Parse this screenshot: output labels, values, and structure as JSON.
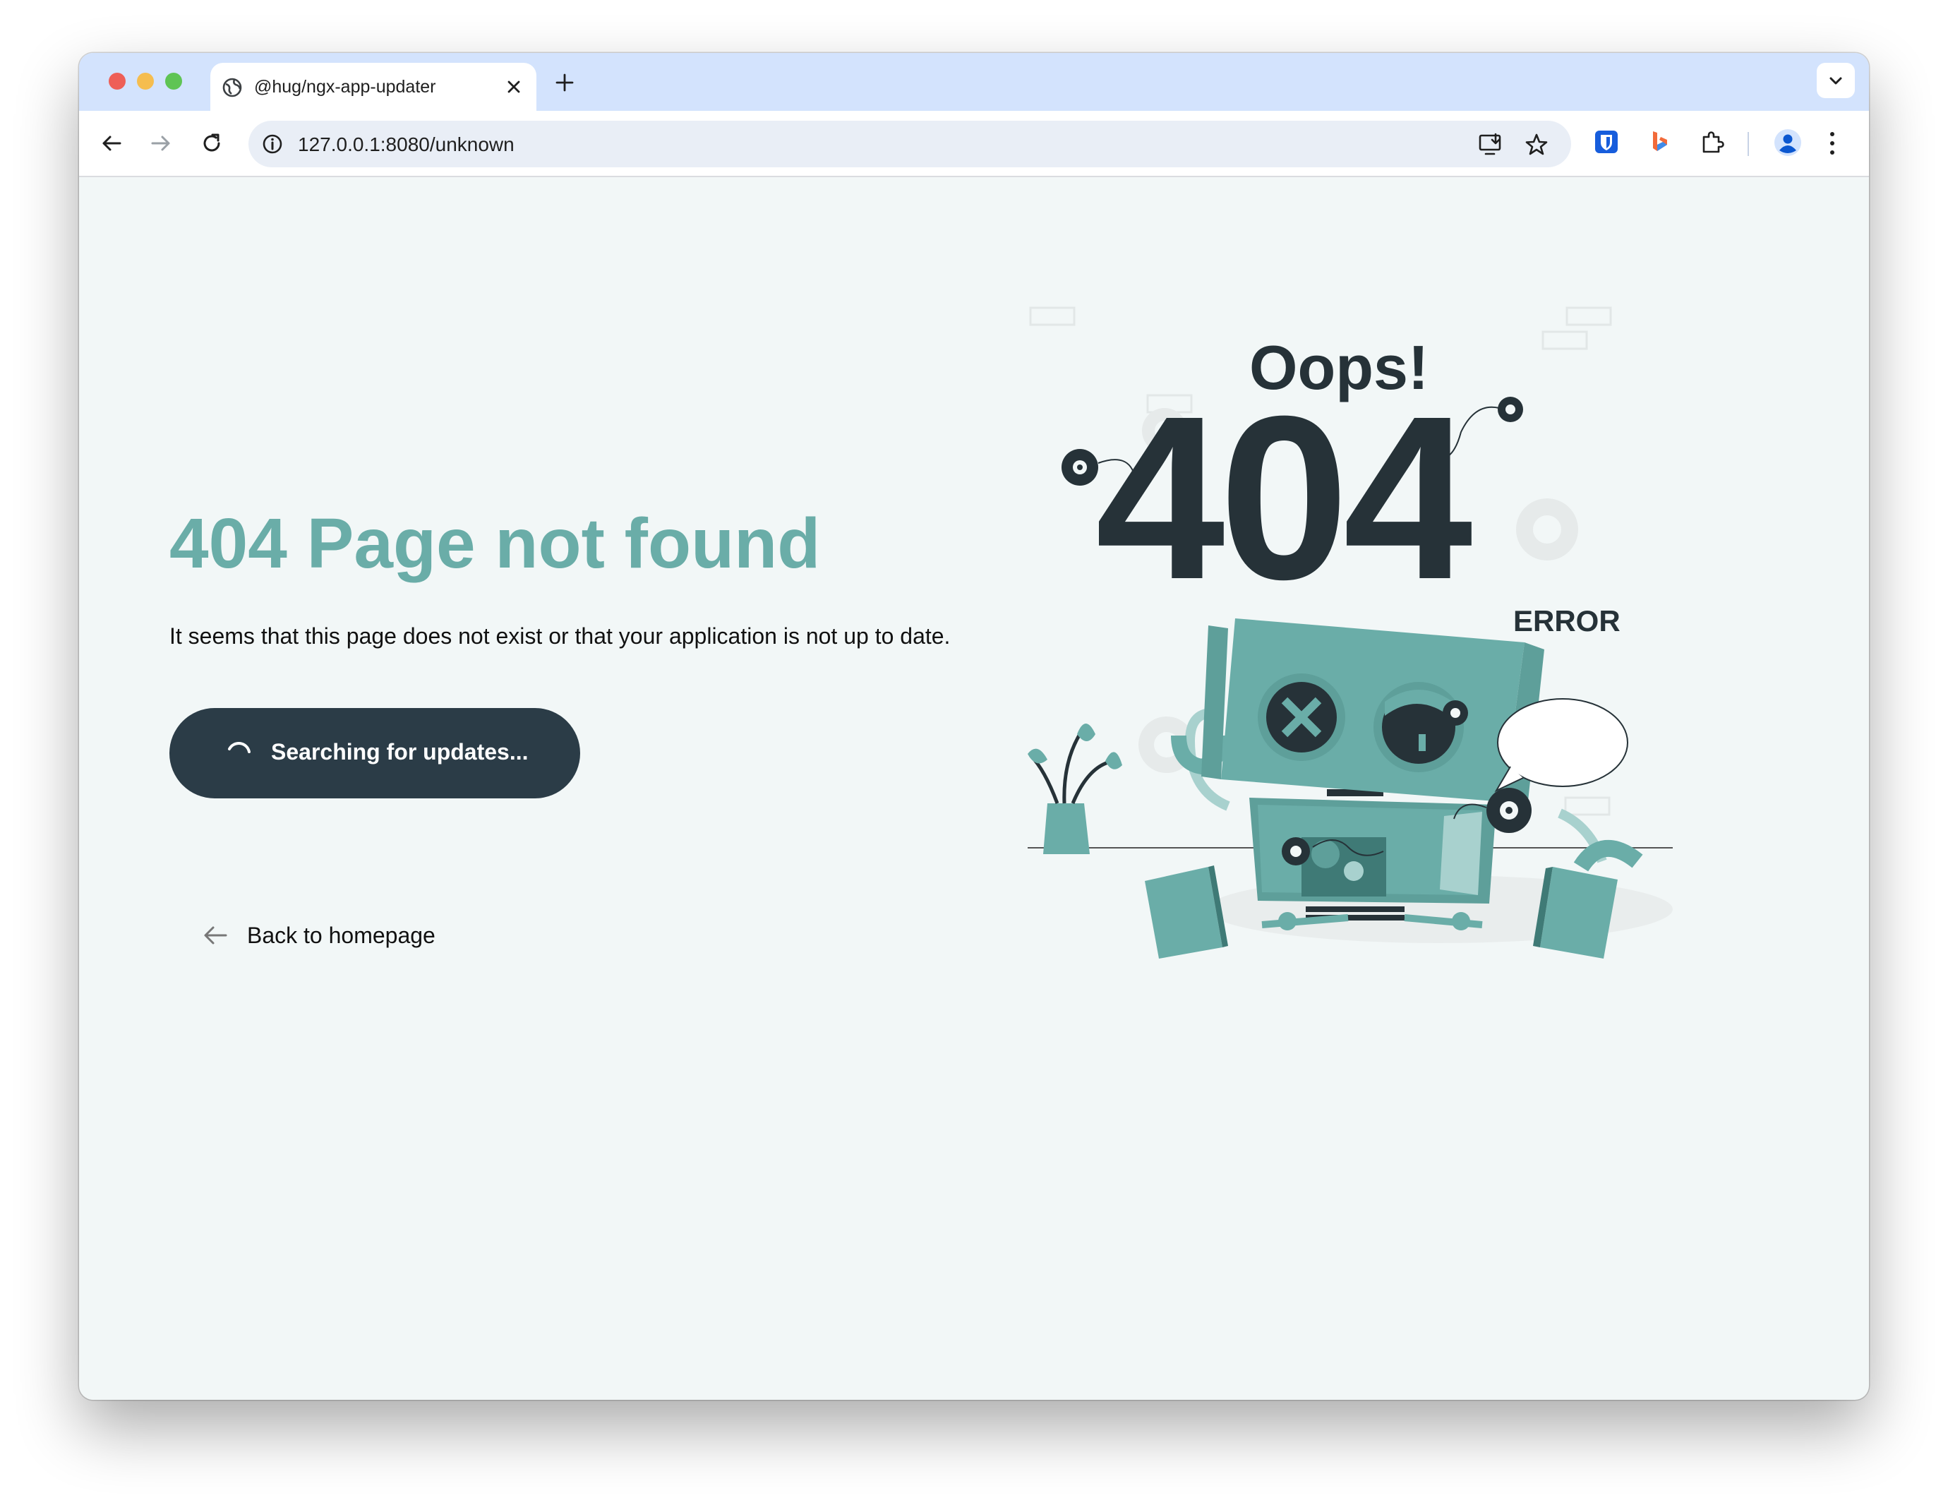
{
  "browser": {
    "tab_title": "@hug/ngx-app-updater",
    "url": "127.0.0.1:8080/unknown"
  },
  "page": {
    "heading": "404 Page not found",
    "description": "It seems that this page does not exist or that your application is not up to date.",
    "update_button_label": "Searching for updates...",
    "back_link_label": "Back to homepage"
  },
  "illustration": {
    "oops_text": "Oops!",
    "code_text": "404",
    "error_text": "ERROR"
  },
  "colors": {
    "accent": "#6aada8",
    "button_dark": "#2b3c47",
    "illustration_dark": "#263238",
    "robot_teal": "#6aada8"
  },
  "icons": [
    "globe-icon",
    "close-icon",
    "plus-icon",
    "chevron-down-icon",
    "back-icon",
    "forward-icon",
    "reload-icon",
    "info-icon",
    "install-icon",
    "star-icon",
    "bitwarden-icon",
    "bing-icon",
    "extensions-icon",
    "profile-icon",
    "menu-icon",
    "spinner-icon",
    "arrow-left-icon"
  ]
}
